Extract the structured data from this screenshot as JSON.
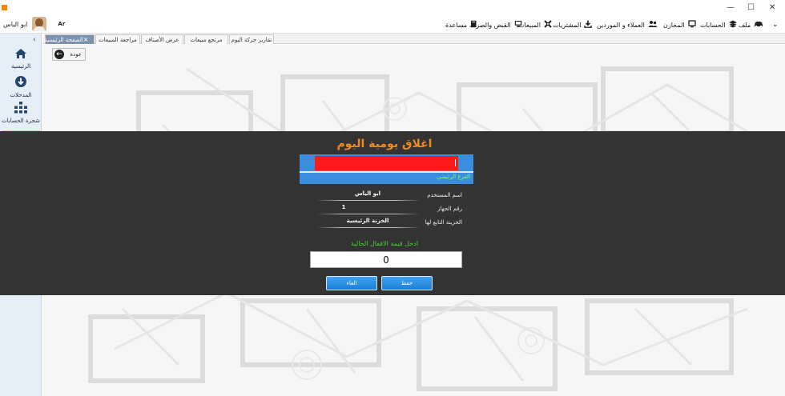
{
  "titlebar": {
    "minimize": "—",
    "maximize": "☐",
    "close": "✕"
  },
  "menubar": {
    "items": [
      {
        "label": "ملف",
        "icon": "car-icon"
      },
      {
        "label": "الحسابات",
        "icon": "stack-icon"
      },
      {
        "label": "المخازن",
        "icon": "monitor-icon"
      },
      {
        "label": "العملاء و الموردين",
        "icon": "users-icon"
      },
      {
        "label": "المشتريات",
        "icon": "download-icon"
      },
      {
        "label": "المبيعات",
        "icon": "tools-icon"
      },
      {
        "label": "القبض والصرف",
        "icon": "desktop-icon"
      },
      {
        "label": "مساعدة",
        "icon": "book-icon"
      }
    ],
    "language_toggle": "Ar",
    "user_name": "ابو الياس"
  },
  "tabs": [
    {
      "label": "الصفحة الرئيسية",
      "active": true,
      "closable": true
    },
    {
      "label": "مراجعة المبيعات",
      "active": false
    },
    {
      "label": "عرض الأصناف",
      "active": false
    },
    {
      "label": "مرتجع مبيعات",
      "active": false
    },
    {
      "label": "تقارير حركة اليوم",
      "active": false
    }
  ],
  "sidebar": {
    "items": [
      {
        "label": "الرئيسية",
        "icon": "home-icon"
      },
      {
        "label": "المدخلات",
        "icon": "arrow-down-circle-icon"
      },
      {
        "label": "شجرة الحسابات",
        "icon": "org-chart-icon"
      }
    ],
    "collapse_glyph": "‹"
  },
  "toolbar": {
    "back_label": "عودة"
  },
  "dialog": {
    "title": "اغلاق يومية اليوم",
    "branch_text": "الفرع الرئيسي",
    "fields": [
      {
        "label": "اسم المستخدم",
        "value": "ابو الياس"
      },
      {
        "label": "رقم الجهاز",
        "value": "1"
      },
      {
        "label": "الخزينة التابع لها",
        "value": "الخزنة الرئيسية"
      }
    ],
    "prompt": "ادخل قيمة الاقفال الحالية",
    "amount_value": "0",
    "save_label": "حفظ",
    "cancel_label": "الغاء"
  },
  "colors": {
    "overlay": "#333333",
    "title": "#ef8a1c",
    "panel_blue": "#3b8ddd",
    "redacted": "#ff1a1a",
    "prompt_green": "#41d12d",
    "button_blue": "#2a8fe3"
  }
}
